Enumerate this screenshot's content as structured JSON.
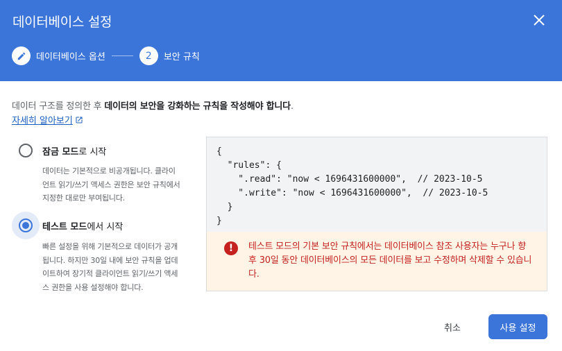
{
  "dialog": {
    "title": "데이터베이스 설정",
    "close_icon": "close-icon"
  },
  "stepper": {
    "steps": [
      {
        "label": "데이터베이스 옵션",
        "state": "completed",
        "icon": "pencil-icon"
      },
      {
        "label": "보안 규칙",
        "state": "active",
        "number": "2"
      }
    ]
  },
  "intro": {
    "text_prefix": "데이터 구조를 정의한 후 ",
    "text_bold": "데이터의 보안을 강화하는 규칙을 작성해야 합니다",
    "text_suffix": ".",
    "learn_more": "자세히 알아보기",
    "learn_more_icon": "open-in-new-icon"
  },
  "options": [
    {
      "title_bold": "잠금 모드",
      "title_rest": "로 시작",
      "selected": false,
      "description": "데이터는 기본적으로 비공개됩니다. 클라이언트 읽기/쓰기 액세스 권한은 보안 규칙에서 지정한 대로만 부여됩니다."
    },
    {
      "title_bold": "테스트 모드",
      "title_rest": "에서 시작",
      "selected": true,
      "description": "빠른 설정을 위해 기본적으로 데이터가 공개됩니다. 하지만 30일 내에 보안 규칙을 업데이트하여 장기적 클라이언트 읽기/쓰기 액세스 권한을 사용 설정해야 합니다."
    }
  ],
  "rules_code": "{\n  \"rules\": {\n    \".read\": \"now < 1696431600000\",  // 2023-10-5\n    \".write\": \"now < 1696431600000\",  // 2023-10-5\n  }\n}",
  "warning": {
    "icon": "alert-icon",
    "text": "테스트 모드의 기본 보안 규칙에서는 데이터베이스 참조 사용자는 누구나 향후 30일 동안 데이터베이스의 모든 데이터를 보고 수정하며 삭제할 수 있습니다."
  },
  "footer": {
    "cancel_label": "취소",
    "enable_label": "사용 설정"
  },
  "colors": {
    "header": "#3b75d9",
    "primary": "#3b75d9",
    "warning_bg": "#fff4e5",
    "warning_text": "#c5221f"
  }
}
